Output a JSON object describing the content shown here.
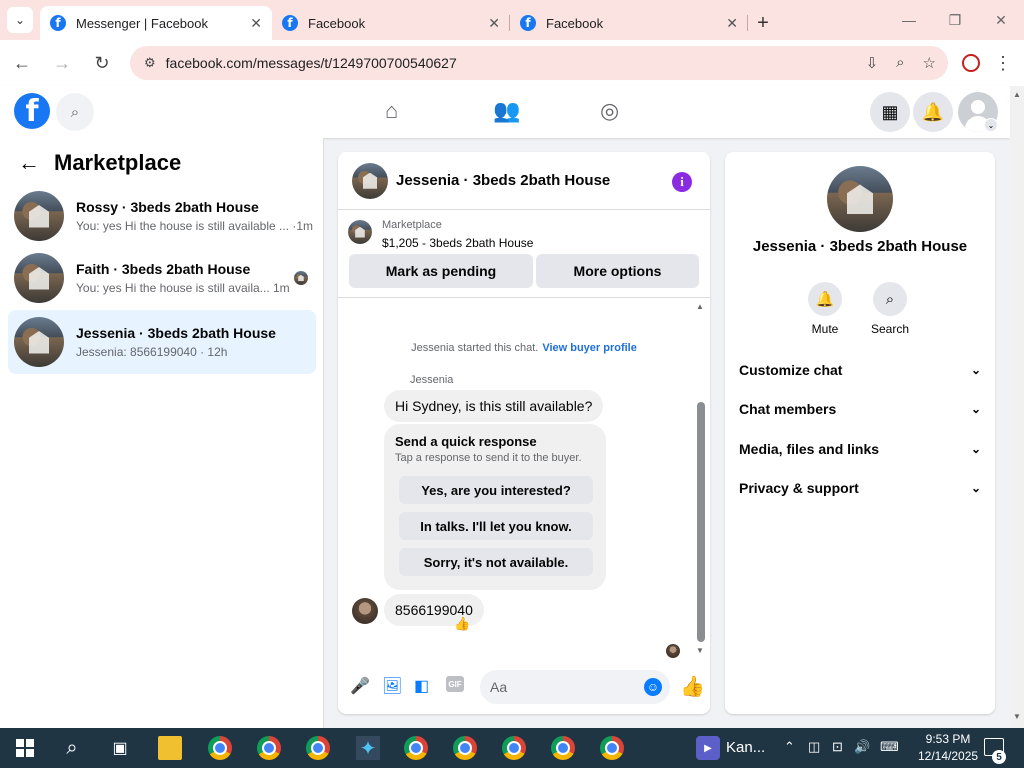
{
  "browser": {
    "tabs": [
      {
        "title": "Messenger | Facebook",
        "active": true
      },
      {
        "title": "Facebook",
        "active": false
      },
      {
        "title": "Facebook",
        "active": false
      }
    ],
    "favicon_letter": "f",
    "url": "facebook.com/messages/t/1249700700540627"
  },
  "left": {
    "title": "Marketplace",
    "conversations": [
      {
        "title": "Rossy · 3beds 2bath House",
        "subtitle": "You: yes Hi the house is still available ... ·1m",
        "selected": false
      },
      {
        "title": "Faith · 3beds 2bath House",
        "subtitle": "You: yes Hi the house is still availa... 1m",
        "selected": false
      },
      {
        "title": "Jessenia · 3beds 2bath House",
        "subtitle": "Jessenia: 8566199040 · 12h",
        "selected": true
      }
    ]
  },
  "chat": {
    "title": "Jessenia · 3beds 2bath House",
    "listing_label": "Marketplace",
    "listing_price": "$1,205 - 3beds 2bath House",
    "mark_pending": "Mark as pending",
    "more_options": "More options",
    "started_text": "Jessenia started this chat.",
    "view_profile": "View buyer profile",
    "sender": "Jessenia",
    "first_message": "Hi Sydney, is this still available?",
    "quick_title": "Send a quick response",
    "quick_subtitle": "Tap a response to send it to the buyer.",
    "quick_responses": [
      "Yes, are you interested?",
      "In talks. I'll let you know.",
      "Sorry, it's not available."
    ],
    "last_message": "8566199040",
    "reaction": "👍",
    "composer_placeholder": "Aa"
  },
  "info": {
    "name": "Jessenia · 3beds 2bath House",
    "actions": [
      {
        "label": "Mute",
        "icon": "bell-icon"
      },
      {
        "label": "Search",
        "icon": "search-icon"
      }
    ],
    "sections": [
      "Customize chat",
      "Chat members",
      "Media, files and links",
      "Privacy & support"
    ]
  },
  "taskbar": {
    "pinned_text": "Kan...",
    "time": "9:53 PM",
    "date": "12/14/2025",
    "notification_count": "5"
  },
  "colors": {
    "facebook_blue": "#1877f2",
    "messenger_blue": "#0a7cff",
    "info_purple": "#8a2be2",
    "chrome_tab_bg": "#fbe3e1",
    "taskbar": "#1f3544"
  }
}
